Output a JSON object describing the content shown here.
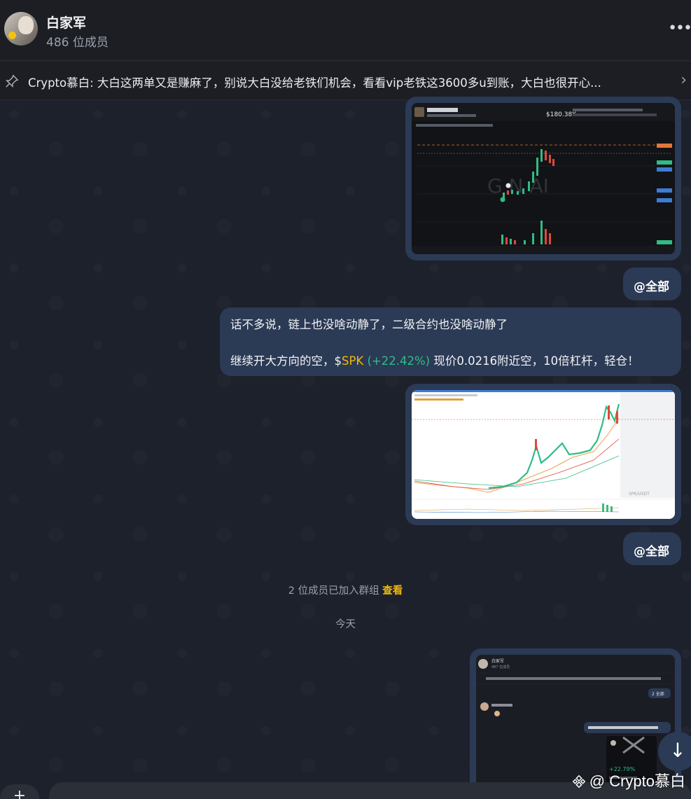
{
  "header": {
    "title": "白家军",
    "subtitle": "486 位成员",
    "more_label": "•••"
  },
  "pinned": {
    "text": "Crypto慕白: 大白这两单又是赚麻了，别说大白没给老铁们机会，看看vip老铁这3600多u到账，大白也很开心...",
    "chevron": "›"
  },
  "messages": {
    "mention_label": "@全部",
    "text1_line1": "话不多说，链上也没啥动静了，二级合约也没啥动静了",
    "text1_prefix": "继续开大方向的空，$",
    "ticker": "SPK",
    "change": "(+22.42%)",
    "text1_suffix": " 现价0.0216附近空，10倍杠杆，轻仓！"
  },
  "chart_screenshot": {
    "price": "$180.38K",
    "brand": "G  N AI"
  },
  "nested_screenshot": {
    "title": "白家军",
    "subtitle": "487 位成员",
    "badge": "2 全部",
    "change": "+22.79%"
  },
  "service": {
    "joined_text": "2 位成员已加入群组",
    "joined_link": "查看",
    "date_label": "今天"
  },
  "footer": {
    "watermark": "@ Crypto慕白",
    "scroll_down": "↓",
    "attach": "+"
  },
  "colors": {
    "bubble": "#2b3a55",
    "accent": "#f0b90b",
    "positive": "#2ebd85"
  }
}
